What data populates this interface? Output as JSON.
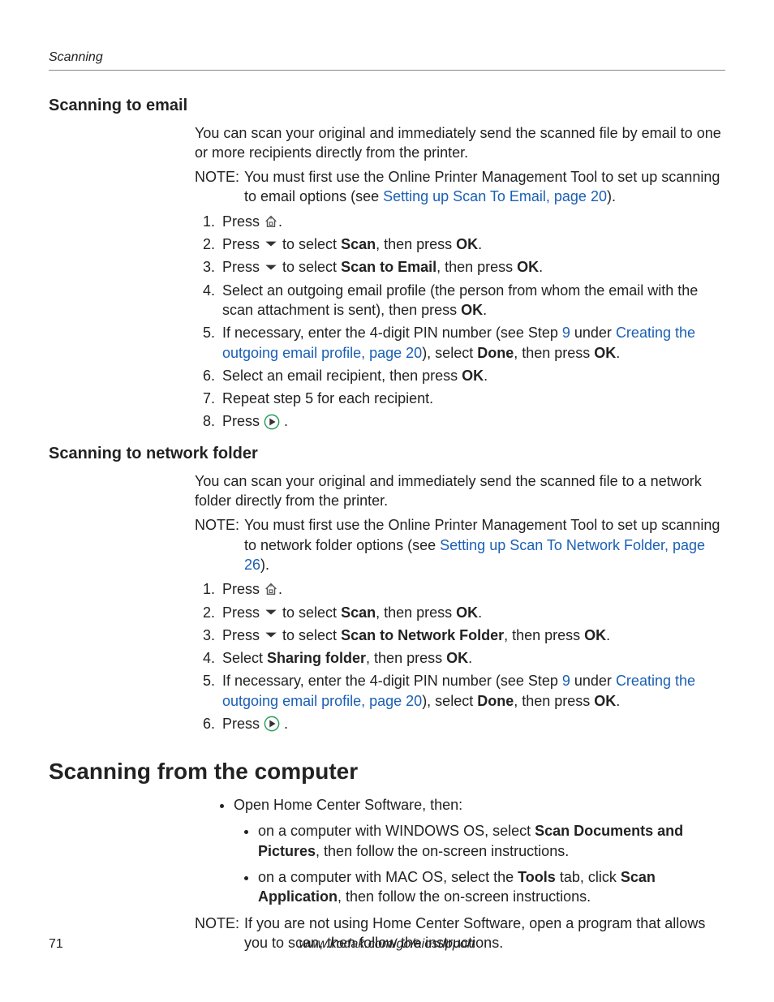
{
  "header": {
    "running": "Scanning"
  },
  "sec_email": {
    "title": "Scanning to email",
    "intro": "You can scan your original and immediately send the scanned file by email to one or more recipients directly from the printer.",
    "note_label": "NOTE:",
    "note_a": "You must first use the Online Printer Management Tool to set up scanning to email options (see ",
    "note_link": "Setting up Scan To Email, page 20",
    "note_b": ").",
    "s1a": "Press ",
    "s1b": ".",
    "s2a": "Press ",
    "s2b": " to select ",
    "s2c": "Scan",
    "s2d": ", then press ",
    "s2e": "OK",
    "s2f": ".",
    "s3a": "Press ",
    "s3b": " to select ",
    "s3c": "Scan to Email",
    "s3d": ", then press ",
    "s3e": "OK",
    "s3f": ".",
    "s4a": "Select an outgoing email profile (the person from whom the email with the scan attachment is sent), then press ",
    "s4b": "OK",
    "s4c": ".",
    "s5a": "If necessary, enter the 4-digit PIN number (see Step ",
    "s5b": "9",
    "s5c": " under ",
    "s5d": "Creating the outgoing email profile, page 20",
    "s5e": "), select ",
    "s5f": "Done",
    "s5g": ", then press ",
    "s5h": "OK",
    "s5i": ".",
    "s6a": "Select an email recipient, then press ",
    "s6b": "OK",
    "s6c": ".",
    "s7": "Repeat step 5 for each recipient.",
    "s8a": "Press ",
    "s8b": " ."
  },
  "sec_net": {
    "title": "Scanning to network folder",
    "intro": "You can scan your original and immediately send the scanned file to a network folder directly from the printer.",
    "note_label": "NOTE:",
    "note_a": "You must first use the Online Printer Management Tool to set up scanning to network folder options (see ",
    "note_link": "Setting up Scan To Network Folder, page 26",
    "note_b": ").",
    "s1a": "Press ",
    "s1b": ".",
    "s2a": "Press ",
    "s2b": " to select ",
    "s2c": "Scan",
    "s2d": ", then press ",
    "s2e": "OK",
    "s2f": ".",
    "s3a": "Press ",
    "s3b": " to select ",
    "s3c": "Scan to Network Folder",
    "s3d": ", then press ",
    "s3e": "OK",
    "s3f": ".",
    "s4a": "Select ",
    "s4b": "Sharing folder",
    "s4c": ", then press ",
    "s4d": "OK",
    "s4e": ".",
    "s5a": "If necessary, enter the 4-digit PIN number (see Step ",
    "s5b": "9",
    "s5c": " under ",
    "s5d": "Creating the outgoing email profile, page 20",
    "s5e": "), select ",
    "s5f": "Done",
    "s5g": ", then press ",
    "s5h": "OK",
    "s5i": ".",
    "s6a": "Press ",
    "s6b": " ."
  },
  "sec_comp": {
    "title": "Scanning from the computer",
    "b1": "Open Home Center Software, then:",
    "sb1a": "on a computer with WINDOWS OS, select ",
    "sb1b": "Scan Documents and Pictures",
    "sb1c": ", then follow the on-screen instructions.",
    "sb2a": "on a computer with MAC OS, select the ",
    "sb2b": "Tools",
    "sb2c": " tab, click ",
    "sb2d": "Scan Application",
    "sb2e": ", then follow the on-screen instructions.",
    "note_label": "NOTE:",
    "note_a": "If you are not using Home Center Software, open a program that allows you to scan, then follow the instructions."
  },
  "footer": {
    "page": "71",
    "url": "www.kodak.com/go/aiosupport"
  }
}
